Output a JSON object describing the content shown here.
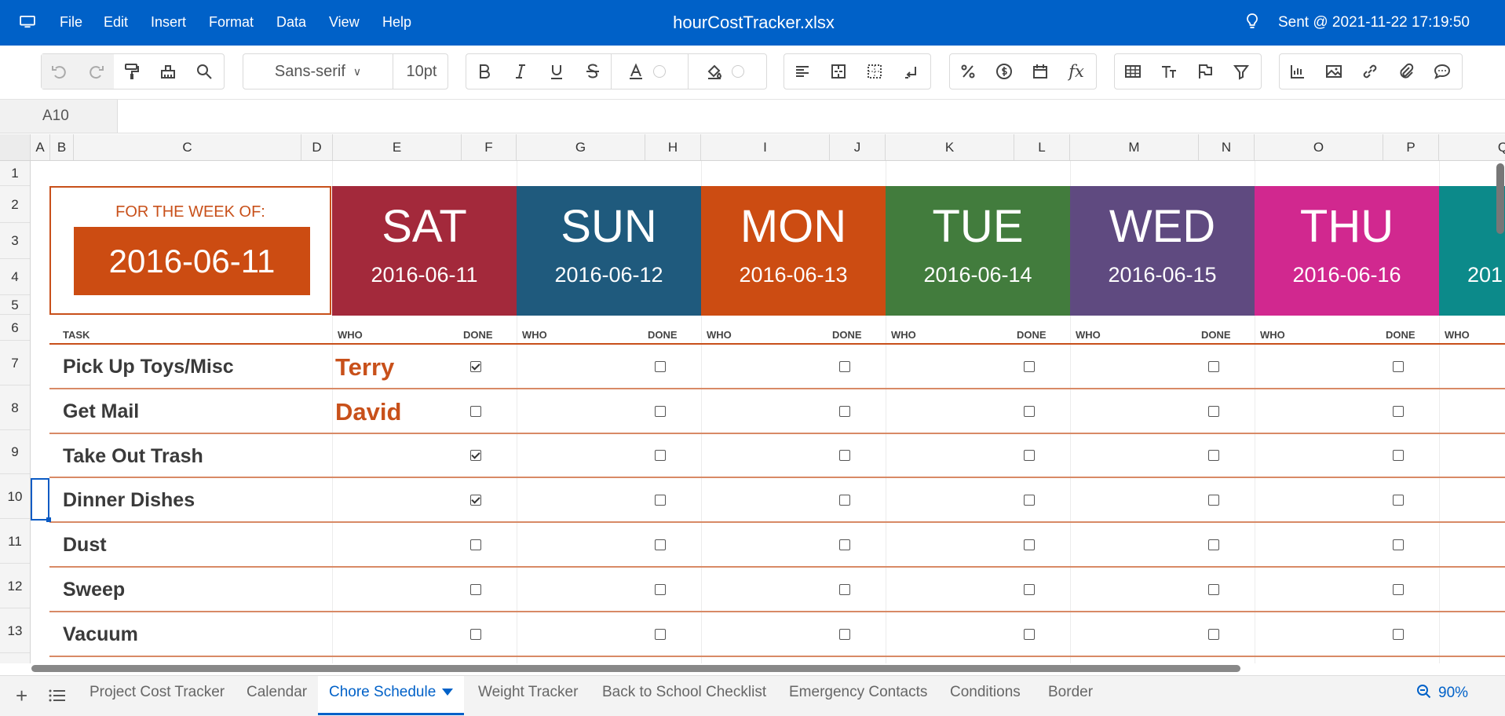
{
  "menu": {
    "items": [
      "File",
      "Edit",
      "Insert",
      "Format",
      "Data",
      "View",
      "Help"
    ],
    "doc_title": "hourCostTracker.xlsx",
    "sent_status": "Sent @ 2021-11-22 17:19:50"
  },
  "toolbar": {
    "font_name": "Sans-serif",
    "font_size": "10pt"
  },
  "name_box": "A10",
  "columns": [
    "A",
    "B",
    "C",
    "D",
    "E",
    "F",
    "G",
    "H",
    "I",
    "J",
    "K",
    "L",
    "M",
    "N",
    "O",
    "P",
    "Q"
  ],
  "rows": [
    "1",
    "2",
    "3",
    "4",
    "5",
    "6",
    "7",
    "8",
    "9",
    "10",
    "11",
    "12",
    "13"
  ],
  "week": {
    "label": "FOR THE WEEK OF:",
    "date": "2016-06-11"
  },
  "days": [
    {
      "name": "SAT",
      "date": "2016-06-11",
      "color": "#a3293b"
    },
    {
      "name": "SUN",
      "date": "2016-06-12",
      "color": "#1f5a7d"
    },
    {
      "name": "MON",
      "date": "2016-06-13",
      "color": "#cc4c12"
    },
    {
      "name": "TUE",
      "date": "2016-06-14",
      "color": "#427c3d"
    },
    {
      "name": "WED",
      "date": "2016-06-15",
      "color": "#5f4a80"
    },
    {
      "name": "THU",
      "date": "2016-06-16",
      "color": "#d1288f"
    },
    {
      "name": "",
      "date": "201",
      "color": "#0c8a8a"
    }
  ],
  "subheaders": {
    "task": "TASK",
    "who": "WHO",
    "done": "DONE"
  },
  "tasks": [
    {
      "name": "Pick Up Toys/Misc",
      "who": "Terry",
      "sat_done": true
    },
    {
      "name": "Get Mail",
      "who": "David",
      "sat_done": false
    },
    {
      "name": "Take Out Trash",
      "who": "",
      "sat_done": true
    },
    {
      "name": "Dinner Dishes",
      "who": "",
      "sat_done": true
    },
    {
      "name": "Dust",
      "who": "",
      "sat_done": false
    },
    {
      "name": "Sweep",
      "who": "",
      "sat_done": false
    },
    {
      "name": "Vacuum",
      "who": "",
      "sat_done": false
    }
  ],
  "sheet_tabs": [
    "Project Cost Tracker",
    "Calendar",
    "Chore Schedule",
    "Weight Tracker",
    "Back to School Checklist",
    "Emergency Contacts",
    "Conditions",
    "Border"
  ],
  "active_tab": "Chore Schedule",
  "zoom": "90%",
  "colors": {
    "brand": "#0061c8",
    "accent": "#c8501a"
  },
  "icons": [
    "monitor-icon",
    "lightbulb-icon",
    "undo-icon",
    "redo-icon",
    "paint-format-icon",
    "clear-format-icon",
    "search-icon",
    "bold-icon",
    "italic-icon",
    "underline-icon",
    "strikethrough-icon",
    "font-color-icon",
    "fill-color-icon",
    "align-left-icon",
    "merge-cells-icon",
    "borders-icon",
    "wrap-text-icon",
    "percent-icon",
    "currency-icon",
    "date-icon",
    "function-icon",
    "table-icon",
    "text-size-icon",
    "flag-icon",
    "filter-icon",
    "chart-icon",
    "image-icon",
    "link-icon",
    "attachment-icon",
    "comment-icon",
    "add-sheet-icon",
    "sheet-list-icon",
    "zoom-out-icon"
  ]
}
